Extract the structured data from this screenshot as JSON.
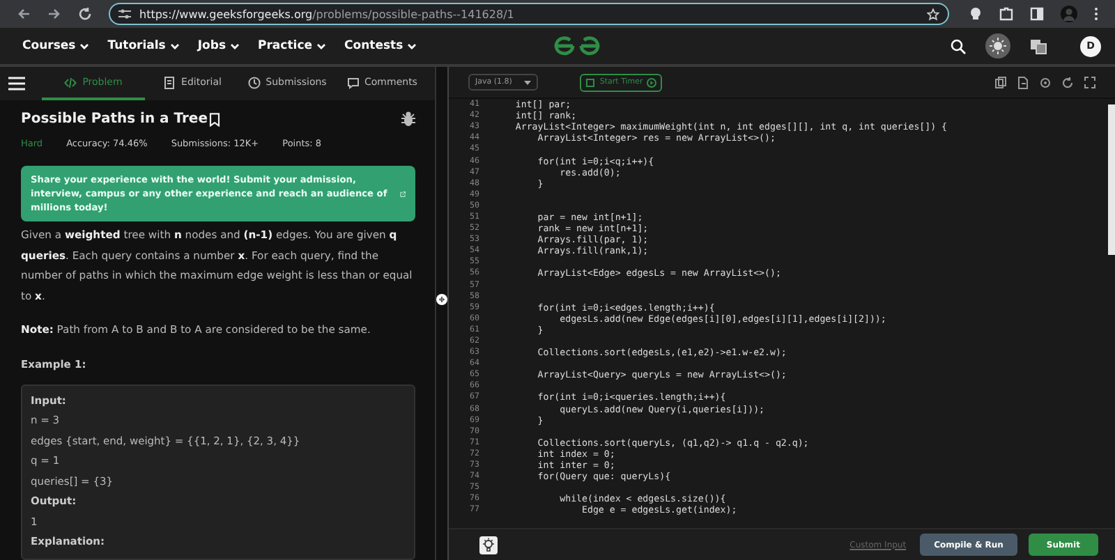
{
  "browser": {
    "url_host": "https://www.geeksforgeeks.org",
    "url_path": "/problems/possible-paths--141628/1"
  },
  "nav": {
    "items": [
      {
        "label": "Courses"
      },
      {
        "label": "Tutorials"
      },
      {
        "label": "Jobs"
      },
      {
        "label": "Practice"
      },
      {
        "label": "Contests"
      }
    ],
    "avatar": "D"
  },
  "tabs": [
    {
      "label": "Problem",
      "selected": true,
      "kind": "code"
    },
    {
      "label": "Editorial",
      "selected": false,
      "kind": "doc"
    },
    {
      "label": "Submissions",
      "selected": false,
      "kind": "clock"
    },
    {
      "label": "Comments",
      "selected": false,
      "kind": "chat"
    }
  ],
  "problem": {
    "title": "Possible Paths in a Tree",
    "difficulty": "Hard",
    "accuracy": "Accuracy: 74.46%",
    "submissions": "Submissions: 12K+",
    "points": "Points: 8",
    "banner": "Share your experience with the world! Submit your admission, interview, campus or any other experience and reach an audience of millions today!",
    "paragraphs": [
      "Given a **weighted** tree with **n** nodes and **(n-1)** edges. You are given **q queries**. Each query contains a number **x**. For each query, find the number of paths in which the maximum edge weight is less than or equal to **x**.",
      "**Note:** Path from A to B and B to A are considered to be the same."
    ],
    "example_title": "Example 1:",
    "example_lines": [
      {
        "text": "Input:",
        "kind": "label"
      },
      {
        "text": "n = 3",
        "kind": "value"
      },
      {
        "text": "edges {start, end, weight} = {{1, 2, 1}, {2, 3, 4}}",
        "kind": "value"
      },
      {
        "text": "q = 1",
        "kind": "value"
      },
      {
        "text": "queries[] = {3}",
        "kind": "value"
      },
      {
        "text": "Output:",
        "kind": "label"
      },
      {
        "text": "1",
        "kind": "value"
      },
      {
        "text": "Explanation:",
        "kind": "label"
      }
    ]
  },
  "editor": {
    "language": "Java (1.8)",
    "timer": "Start Timer",
    "lines": [
      {
        "n": "41",
        "code": "    int[] par;"
      },
      {
        "n": "42",
        "code": "    int[] rank;"
      },
      {
        "n": "43",
        "code": "    ArrayList<Integer> maximumWeight(int n, int edges[][], int q, int queries[]) {"
      },
      {
        "n": "44",
        "code": "        ArrayList<Integer> res = new ArrayList<>();"
      },
      {
        "n": "45"
      },
      {
        "n": "46",
        "code": "        for(int i=0;i<q;i++){"
      },
      {
        "n": "47",
        "code": "            res.add(0);"
      },
      {
        "n": "48",
        "code": "        }"
      },
      {
        "n": "49"
      },
      {
        "n": "50"
      },
      {
        "n": "51",
        "code": "        par = new int[n+1];"
      },
      {
        "n": "52",
        "code": "        rank = new int[n+1];"
      },
      {
        "n": "53",
        "code": "        Arrays.fill(par, 1);"
      },
      {
        "n": "54",
        "code": "        Arrays.fill(rank,1);"
      },
      {
        "n": "55"
      },
      {
        "n": "56",
        "code": "        ArrayList<Edge> edgesLs = new ArrayList<>();"
      },
      {
        "n": "57"
      },
      {
        "n": "58"
      },
      {
        "n": "59",
        "code": "        for(int i=0;i<edges.length;i++){"
      },
      {
        "n": "60",
        "code": "            edgesLs.add(new Edge(edges[i][0],edges[i][1],edges[i][2]));"
      },
      {
        "n": "61",
        "code": "        }"
      },
      {
        "n": "62"
      },
      {
        "n": "63",
        "code": "        Collections.sort(edgesLs,(e1,e2)->e1.w-e2.w);"
      },
      {
        "n": "64"
      },
      {
        "n": "65",
        "code": "        ArrayList<Query> queryLs = new ArrayList<>();"
      },
      {
        "n": "66"
      },
      {
        "n": "67",
        "code": "        for(int i=0;i<queries.length;i++){"
      },
      {
        "n": "68",
        "code": "            queryLs.add(new Query(i,queries[i]));"
      },
      {
        "n": "69",
        "code": "        }"
      },
      {
        "n": "70"
      },
      {
        "n": "71",
        "code": "        Collections.sort(queryLs, (q1,q2)-> q1.q - q2.q);"
      },
      {
        "n": "72",
        "code": "        int index = 0;"
      },
      {
        "n": "73",
        "code": "        int inter = 0;"
      },
      {
        "n": "74",
        "code": "        for(Query que: queryLs){"
      },
      {
        "n": "75"
      },
      {
        "n": "76",
        "code": "            while(index < edgesLs.size()){"
      },
      {
        "n": "77",
        "code": "                Edge e = edgesLs.get(index);"
      }
    ],
    "custom_input": "Custom Input",
    "compile": "Compile & Run",
    "submit": "Submit"
  }
}
